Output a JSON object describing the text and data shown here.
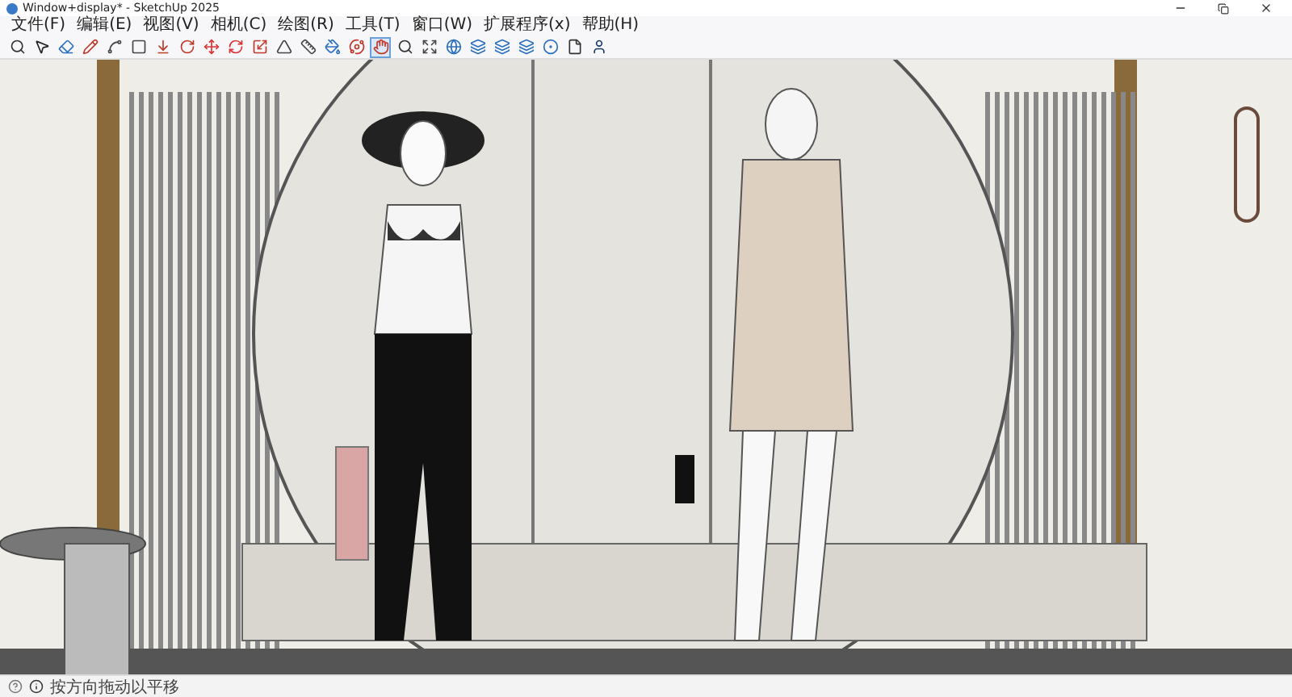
{
  "window": {
    "title": "Window+display* - SketchUp 2025"
  },
  "menu": [
    "文件(F)",
    "编辑(E)",
    "视图(V)",
    "相机(C)",
    "绘图(R)",
    "工具(T)",
    "窗口(W)",
    "扩展程序(x)",
    "帮助(H)"
  ],
  "toolbar": [
    {
      "kind": "zoom",
      "selected": false
    },
    {
      "kind": "select",
      "selected": false
    },
    {
      "kind": "eraser",
      "selected": false
    },
    {
      "kind": "pencil",
      "selected": false
    },
    {
      "kind": "arc",
      "selected": false
    },
    {
      "kind": "rect",
      "selected": false
    },
    {
      "kind": "push",
      "selected": false
    },
    {
      "kind": "rotate",
      "selected": false
    },
    {
      "kind": "move",
      "selected": false
    },
    {
      "kind": "refresh",
      "selected": false
    },
    {
      "kind": "scale",
      "selected": false
    },
    {
      "kind": "triangle",
      "selected": false
    },
    {
      "kind": "tape",
      "selected": false
    },
    {
      "kind": "paint",
      "selected": false
    },
    {
      "kind": "orbit",
      "selected": false
    },
    {
      "kind": "pan",
      "selected": true
    },
    {
      "kind": "zoom",
      "selected": false
    },
    {
      "kind": "extents",
      "selected": false
    },
    {
      "kind": "globe",
      "selected": false
    },
    {
      "kind": "layers",
      "selected": false
    },
    {
      "kind": "layers",
      "selected": false
    },
    {
      "kind": "layers",
      "selected": false
    },
    {
      "kind": "circle",
      "selected": false
    },
    {
      "kind": "file",
      "selected": false
    },
    {
      "kind": "user",
      "selected": false
    }
  ],
  "status_bar": {
    "text": "按方向拖动以平移"
  }
}
